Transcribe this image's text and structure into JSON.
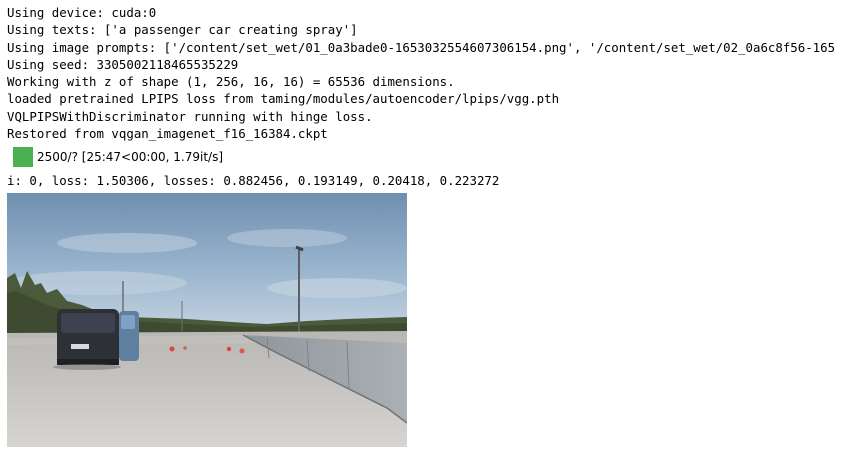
{
  "output": {
    "lines": [
      "Using device: cuda:0",
      "Using texts: ['a passenger car creating spray']",
      "Using image prompts: ['/content/set_wet/01_0a3bade0-1653032554607306154.png', '/content/set_wet/02_0a6c8f56-165",
      "Using seed: 3305002118465535229",
      "Working with z of shape (1, 256, 16, 16) = 65536 dimensions.",
      "loaded pretrained LPIPS loss from taming/modules/autoencoder/lpips/vgg.pth",
      "VQLPIPSWithDiscriminator running with hinge loss.",
      "Restored from vqgan_imagenet_f16_16384.ckpt"
    ],
    "progress": {
      "text": "2500/? [25:47<00:00, 1.79it/s]",
      "fill_fraction": 1.0,
      "color": "#4cb050"
    },
    "loss_line": "i: 0, loss: 1.50306, losses: 0.882456, 0.193149, 0.20418, 0.223272"
  },
  "image": {
    "description_icon": "generated-image"
  }
}
